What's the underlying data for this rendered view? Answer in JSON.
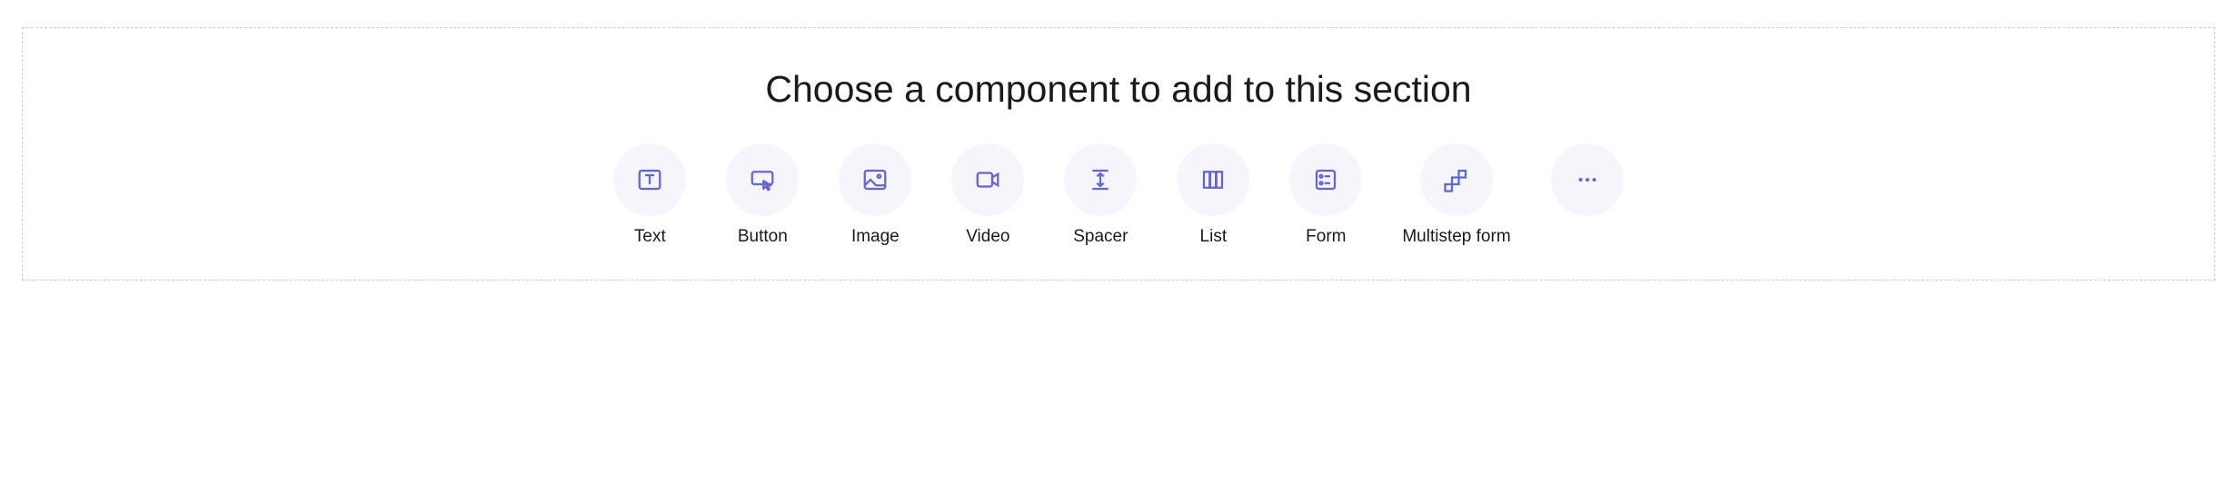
{
  "section": {
    "title": "Choose a component to add to this section"
  },
  "components": {
    "text": {
      "label": "Text"
    },
    "button": {
      "label": "Button"
    },
    "image": {
      "label": "Image"
    },
    "video": {
      "label": "Video"
    },
    "spacer": {
      "label": "Spacer"
    },
    "list": {
      "label": "List"
    },
    "form": {
      "label": "Form"
    },
    "multistep_form": {
      "label": "Multistep form"
    }
  },
  "colors": {
    "icon_bg": "#f6f5fc",
    "icon_stroke": "#6264d8",
    "border": "#cccccc"
  }
}
